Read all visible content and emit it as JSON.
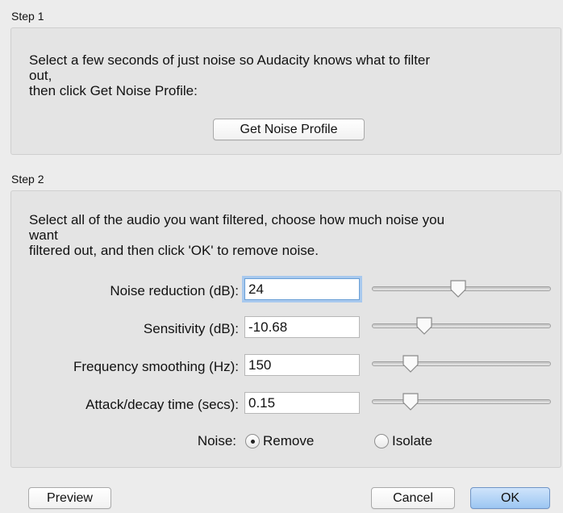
{
  "step1": {
    "title": "Step 1",
    "desc_line1": "Select a few seconds of just noise so Audacity knows what to filter",
    "desc_line2": "out,",
    "desc_line3": "then click Get Noise Profile:",
    "get_profile_label": "Get Noise Profile"
  },
  "step2": {
    "title": "Step 2",
    "desc_line1": "Select all of the audio you want filtered, choose how much noise you",
    "desc_line2": "want",
    "desc_line3": "filtered out, and then click 'OK' to remove noise.",
    "rows": [
      {
        "label": "Noise reduction (dB):",
        "value": "24",
        "slider_fraction": 0.48
      },
      {
        "label": "Sensitivity (dB):",
        "value": "-10.68",
        "slider_fraction": 0.27
      },
      {
        "label": "Frequency smoothing (Hz):",
        "value": "150",
        "slider_fraction": 0.18
      },
      {
        "label": "Attack/decay time (secs):",
        "value": "0.15",
        "slider_fraction": 0.18
      }
    ],
    "noise": {
      "label": "Noise:",
      "options": [
        "Remove",
        "Isolate"
      ],
      "selected": "Remove"
    }
  },
  "buttons": {
    "preview": "Preview",
    "cancel": "Cancel",
    "ok": "OK"
  },
  "colors": {
    "background": "#ececec",
    "group_background": "#e4e4e4",
    "primary_button": "#9cc6f2",
    "focus_ring": "#a8c9ee"
  }
}
